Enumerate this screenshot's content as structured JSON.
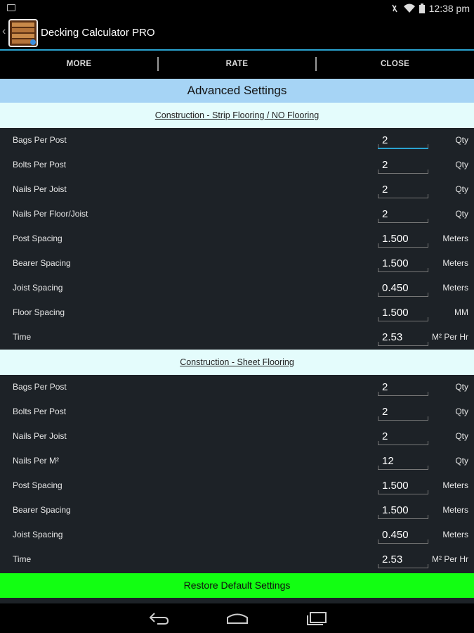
{
  "status_bar": {
    "time": "12:38 pm"
  },
  "app": {
    "title": "Decking Calculator PRO"
  },
  "menu": {
    "items": [
      "MORE",
      "RATE",
      "CLOSE"
    ]
  },
  "advanced_title": "Advanced Settings",
  "sections": [
    {
      "title": "Construction - Strip Flooring / NO Flooring",
      "rows": [
        {
          "label": "Bags Per Post",
          "value": "2",
          "unit": "Qty"
        },
        {
          "label": "Bolts Per Post",
          "value": "2",
          "unit": "Qty"
        },
        {
          "label": "Nails Per Joist",
          "value": "2",
          "unit": "Qty"
        },
        {
          "label": "Nails Per Floor/Joist",
          "value": "2",
          "unit": "Qty"
        },
        {
          "label": "Post Spacing",
          "value": "1.500",
          "unit": "Meters"
        },
        {
          "label": "Bearer Spacing",
          "value": "1.500",
          "unit": "Meters"
        },
        {
          "label": "Joist Spacing",
          "value": "0.450",
          "unit": "Meters"
        },
        {
          "label": "Floor Spacing",
          "value": "1.500",
          "unit": "MM"
        },
        {
          "label": "Time",
          "value": "2.53",
          "unit": "M² Per Hr"
        }
      ]
    },
    {
      "title": "Construction - Sheet Flooring",
      "rows": [
        {
          "label": "Bags Per Post",
          "value": "2",
          "unit": "Qty"
        },
        {
          "label": "Bolts Per Post",
          "value": "2",
          "unit": "Qty"
        },
        {
          "label": "Nails Per Joist",
          "value": "2",
          "unit": "Qty"
        },
        {
          "label": "Nails Per M²",
          "value": "12",
          "unit": "Qty"
        },
        {
          "label": "Post Spacing",
          "value": "1.500",
          "unit": "Meters"
        },
        {
          "label": "Bearer Spacing",
          "value": "1.500",
          "unit": "Meters"
        },
        {
          "label": "Joist Spacing",
          "value": "0.450",
          "unit": "Meters"
        },
        {
          "label": "Time",
          "value": "2.53",
          "unit": "M² Per Hr"
        }
      ]
    }
  ],
  "restore_label": "Restore Default Settings",
  "colors": {
    "accent": "#2aa3d0",
    "section_header_bg": "#a6d4f5",
    "sub_header_bg": "#e4fcfc",
    "row_bg": "#1d2227",
    "restore_bg": "#12ff12"
  },
  "icons": {
    "status_left": "notification-icon",
    "status_right": [
      "mute-icon",
      "wifi-icon",
      "battery-icon"
    ],
    "nav": [
      "back-icon",
      "home-icon",
      "recent-apps-icon"
    ]
  }
}
